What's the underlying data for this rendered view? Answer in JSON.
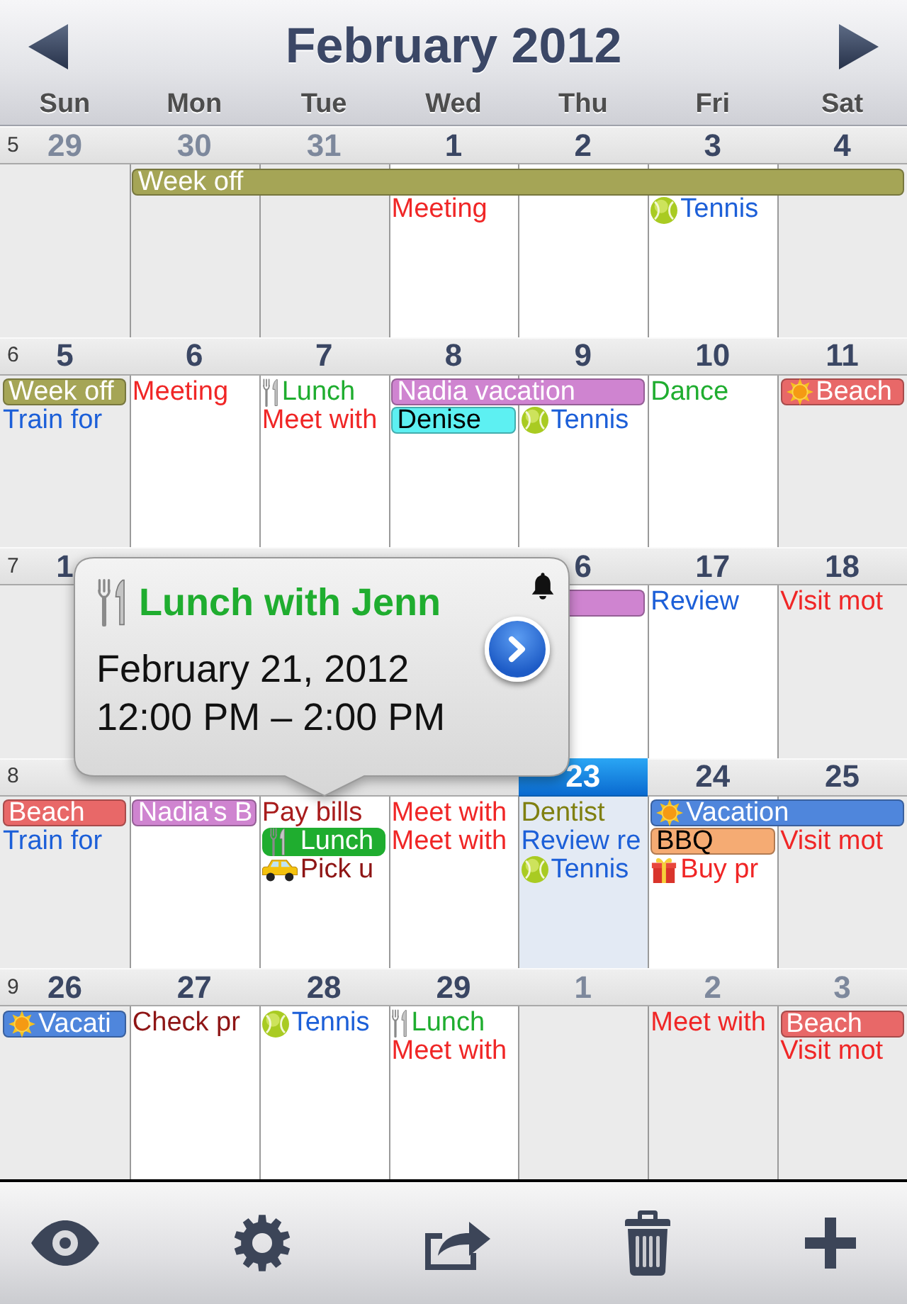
{
  "header": {
    "title": "February 2012",
    "weekdays": [
      "Sun",
      "Mon",
      "Tue",
      "Wed",
      "Thu",
      "Fri",
      "Sat"
    ]
  },
  "weeks": [
    {
      "number": "5",
      "days": [
        {
          "date": "29",
          "other_month": true,
          "today": false
        },
        {
          "date": "30",
          "other_month": true,
          "today": false,
          "events": [
            {
              "kind": "bar",
              "title": "Week off",
              "color": "#a5a556",
              "selected": false
            }
          ]
        },
        {
          "date": "31",
          "other_month": true,
          "today": false,
          "events": [
            {
              "kind": "continued"
            }
          ]
        },
        {
          "date": "1",
          "other_month": false,
          "today": false,
          "events": [
            {
              "kind": "continued"
            },
            {
              "kind": "text",
              "title": "Meeting",
              "color": "#f02626",
              "selected": false
            }
          ]
        },
        {
          "date": "2",
          "other_month": false,
          "today": false,
          "events": [
            {
              "kind": "continued"
            }
          ]
        },
        {
          "date": "3",
          "other_month": false,
          "today": false,
          "events": [
            {
              "kind": "continued"
            },
            {
              "kind": "tennis",
              "title": "Tennis",
              "color": "#1c5fd8",
              "selected": false
            }
          ]
        },
        {
          "date": "4",
          "other_month": false,
          "today": false,
          "events": [
            {
              "kind": "continued"
            }
          ]
        }
      ]
    },
    {
      "number": "6",
      "days": [
        {
          "date": "5",
          "other_month": false,
          "today": false,
          "events": [
            {
              "kind": "bar",
              "title": "Week off",
              "color": "#a5a556",
              "selected": false
            },
            {
              "kind": "text",
              "title": "Train for",
              "color": "#1c5fd8",
              "selected": false
            }
          ]
        },
        {
          "date": "6",
          "other_month": false,
          "today": false,
          "events": [
            {
              "kind": "text",
              "title": "Meeting",
              "color": "#f02626",
              "selected": false
            }
          ]
        },
        {
          "date": "7",
          "other_month": false,
          "today": false,
          "events": [
            {
              "kind": "meal",
              "title": "Lunch",
              "color": "#1fad2f",
              "selected": false
            },
            {
              "kind": "text",
              "title": "Meet with",
              "color": "#f02626",
              "selected": false
            }
          ]
        },
        {
          "date": "8",
          "other_month": false,
          "today": false,
          "events": [
            {
              "kind": "bar",
              "title": "Nadia vacation",
              "color": "#cf84d0",
              "selected": false
            },
            {
              "kind": "bar",
              "title": "Denise",
              "color": "#5df0f2",
              "selected": false
            }
          ]
        },
        {
          "date": "9",
          "other_month": false,
          "today": false,
          "events": [
            {
              "kind": "continued"
            },
            {
              "kind": "tennis",
              "title": "Tennis",
              "color": "#1c5fd8",
              "selected": false
            }
          ]
        },
        {
          "date": "10",
          "other_month": false,
          "today": false,
          "events": [
            {
              "kind": "text",
              "title": "Dance",
              "color": "#1fad2f",
              "selected": false
            }
          ]
        },
        {
          "date": "11",
          "other_month": false,
          "today": false,
          "events": [
            {
              "kind": "holiday",
              "title": "Beach",
              "color": "#e86868",
              "selected": false
            }
          ]
        }
      ]
    },
    {
      "number": "7",
      "days": [
        {
          "date": "1",
          "other_month": false,
          "today": false
        },
        {
          "today": false
        },
        {
          "today": false
        },
        {
          "today": false
        },
        {
          "date": "6",
          "other_month": false,
          "today": false,
          "events": [
            {
              "kind": "bar",
              "color": "#cf84d0",
              "selected": false
            }
          ]
        },
        {
          "date": "17",
          "other_month": false,
          "today": false,
          "events": [
            {
              "kind": "text",
              "title": "Review",
              "color": "#1c5fd8",
              "selected": false
            }
          ]
        },
        {
          "date": "18",
          "other_month": false,
          "today": false,
          "events": [
            {
              "kind": "text",
              "title": "Visit mot",
              "color": "#f02626",
              "selected": false
            }
          ]
        }
      ]
    },
    {
      "number": "8",
      "days": [
        {
          "events": [
            {
              "kind": "bar",
              "title": "Beach",
              "color": "#e86868",
              "selected": false
            },
            {
              "kind": "text",
              "title": "Train for",
              "color": "#1c5fd8",
              "selected": false
            }
          ]
        },
        {
          "events": [
            {
              "kind": "bar",
              "title": "Nadia's B",
              "color": "#cf84d0",
              "selected": false
            }
          ]
        },
        {
          "events": [
            {
              "kind": "text",
              "title": "Pay bills",
              "color": "#a81c1c",
              "selected": false
            },
            {
              "kind": "meal",
              "title": "Lunch",
              "color": "#1fad2f",
              "selected": true
            },
            {
              "kind": "taxi",
              "title": "Pick u",
              "color": "#8e1515",
              "selected": false
            }
          ]
        },
        {
          "events": [
            {
              "kind": "text",
              "title": "Meet with",
              "color": "#f02626",
              "selected": false
            },
            {
              "kind": "text",
              "title": "Meet with",
              "color": "#f02626",
              "selected": false
            }
          ]
        },
        {
          "date": "23",
          "other_month": false,
          "today": true,
          "events": [
            {
              "kind": "text",
              "title": "Dentist",
              "color": "#7f7f10",
              "selected": false
            },
            {
              "kind": "text",
              "title": "Review re",
              "color": "#1c5fd8",
              "selected": false
            },
            {
              "kind": "tennis",
              "title": "Tennis",
              "color": "#1c5fd8",
              "selected": false
            }
          ]
        },
        {
          "date": "24",
          "other_month": false,
          "today": false,
          "events": [
            {
              "kind": "holiday",
              "title": "Vacation",
              "color": "#4f86dc",
              "selected": false
            },
            {
              "kind": "bar",
              "title": "BBQ",
              "color": "#f5ab73",
              "selected": false
            },
            {
              "kind": "present",
              "title": "Buy pr",
              "color": "#f02626",
              "selected": false
            }
          ]
        },
        {
          "date": "25",
          "other_month": false,
          "today": false,
          "events": [
            {
              "kind": "continued"
            },
            {
              "kind": "text",
              "title": "Visit mot",
              "color": "#f02626",
              "selected": false
            }
          ]
        }
      ]
    },
    {
      "number": "9",
      "days": [
        {
          "date": "26",
          "other_month": false,
          "today": false,
          "events": [
            {
              "kind": "holiday",
              "title": "Vacati",
              "color": "#4f86dc",
              "selected": false
            }
          ]
        },
        {
          "date": "27",
          "other_month": false,
          "today": false,
          "events": [
            {
              "kind": "text",
              "title": "Check pr",
              "color": "#8e1515",
              "selected": false
            }
          ]
        },
        {
          "date": "28",
          "other_month": false,
          "today": false,
          "events": [
            {
              "kind": "tennis",
              "title": "Tennis",
              "color": "#1c5fd8",
              "selected": false
            }
          ]
        },
        {
          "date": "29",
          "other_month": false,
          "today": false,
          "events": [
            {
              "kind": "meal",
              "title": "Lunch",
              "color": "#1fad2f",
              "selected": false
            },
            {
              "kind": "text",
              "title": "Meet with",
              "color": "#f02626",
              "selected": false
            }
          ]
        },
        {
          "date": "1",
          "other_month": true,
          "today": false
        },
        {
          "date": "2",
          "other_month": true,
          "today": false,
          "events": [
            {
              "kind": "text",
              "title": "Meet with",
              "color": "#f02626",
              "selected": false
            }
          ]
        },
        {
          "date": "3",
          "other_month": true,
          "today": false,
          "events": [
            {
              "kind": "bar",
              "title": "Beach",
              "color": "#e86868",
              "selected": false
            },
            {
              "kind": "text",
              "title": "Visit mot",
              "color": "#f02626",
              "selected": false
            }
          ]
        }
      ]
    }
  ],
  "popover": {
    "title": "Lunch with Jenn",
    "date": "February 21, 2012",
    "time": "12:00 PM – 2:00 PM",
    "alarm": true
  }
}
